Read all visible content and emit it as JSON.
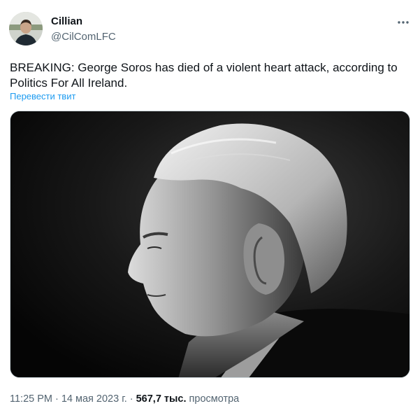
{
  "author": {
    "name": "Cillian",
    "handle": "@CilComLFC"
  },
  "tweet": {
    "text": "BREAKING: George Soros has died of a violent heart attack, according to Politics For All Ireland.",
    "translate_label": "Перевести твит"
  },
  "meta": {
    "time": "11:25 PM",
    "separator": "·",
    "date": "14 мая 2023 г.",
    "views_count": "567,7 тыс.",
    "views_label": "просмотра"
  },
  "icons": {
    "more": "more-horizontal-icon"
  },
  "colors": {
    "link": "#1d9bf0",
    "secondary_text": "#536471",
    "primary_text": "#0f1419"
  }
}
